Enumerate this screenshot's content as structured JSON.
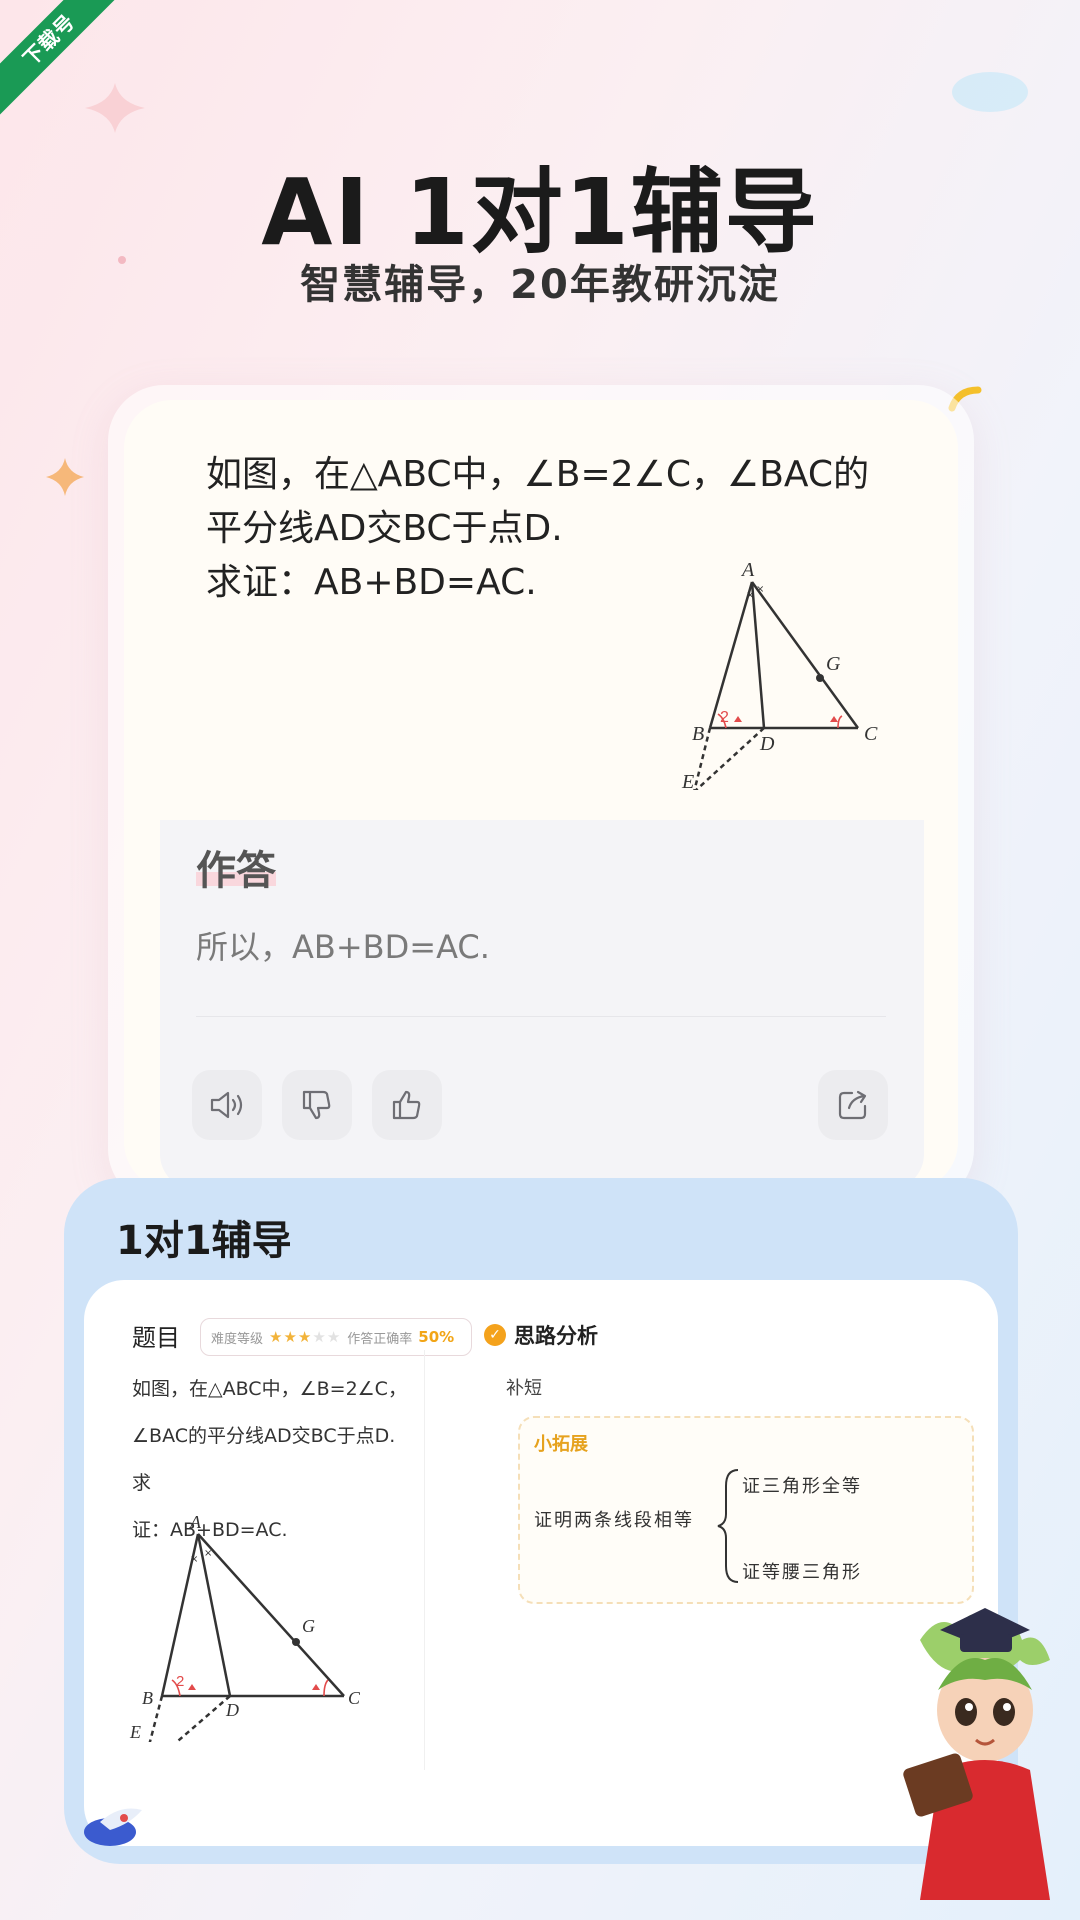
{
  "badge": {
    "download": "下载号"
  },
  "hero": {
    "title": "AI 1对1辅导",
    "subtitle": "智慧辅导，20年教研沉淀"
  },
  "question_card": {
    "lines": [
      "如图，在△ABC中，∠B=2∠C，∠BAC的",
      "平分线AD交BC于点D.",
      "求证：AB+BD=AC."
    ],
    "figure_labels": {
      "A": "A",
      "B": "B",
      "C": "C",
      "D": "D",
      "E": "E",
      "G": "G",
      "angle2": "2"
    },
    "answer_label": "作答",
    "answer_text": "所以，AB+BD=AC.",
    "actions": [
      "speaker-icon",
      "thumbs-down-icon",
      "thumbs-up-icon",
      "share-icon"
    ]
  },
  "tutor": {
    "title": "1对1辅导",
    "question_label": "题目",
    "difficulty_label": "难度等级",
    "difficulty_stars": 3,
    "difficulty_max": 5,
    "accuracy_label": "作答正确率",
    "accuracy_value": "50%",
    "question_lines": [
      "如图，在△ABC中，∠B=2∠C，",
      "∠BAC的平分线AD交BC于点D. 求",
      "证：AB+BD=AC."
    ],
    "analysis_title": "思路分析",
    "analysis_note": "补短",
    "expand_title": "小拓展",
    "expand_main": "证明两条线段相等",
    "expand_branch_1": "证三角形全等",
    "expand_branch_2": "证等腰三角形"
  },
  "colors": {
    "ribbon": "#1a9a55",
    "accent_orange": "#f4a21c",
    "panel_blue": "#cfe3f8",
    "angle_red": "#e24b4b"
  }
}
